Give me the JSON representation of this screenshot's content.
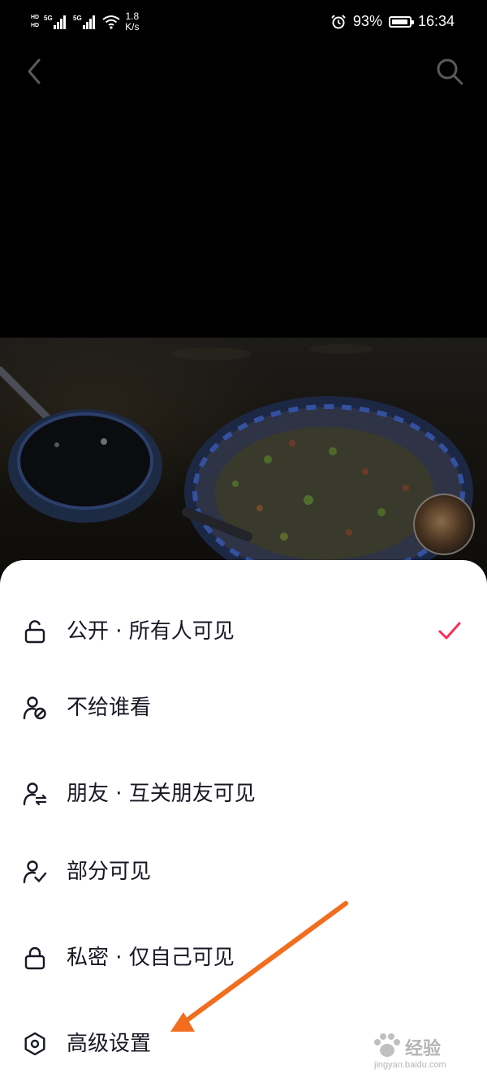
{
  "status_bar": {
    "hd1": "HD",
    "hd2": "HD",
    "net1": "5G",
    "net2": "5G",
    "speed_value": "1.8",
    "speed_unit": "K/s",
    "battery": "93%",
    "battery_level": 0.93,
    "time": "16:34"
  },
  "nav": {
    "back_icon": "chevron-left-icon",
    "search_icon": "search-icon"
  },
  "privacy_options": [
    {
      "label": "公开 · 所有人可见",
      "icon": "unlock-icon",
      "selected": true
    },
    {
      "label": "不给谁看",
      "icon": "user-blocked-icon",
      "selected": false
    },
    {
      "label": "朋友 · 互关朋友可见",
      "icon": "user-mutual-icon",
      "selected": false
    },
    {
      "label": "部分可见",
      "icon": "user-check-icon",
      "selected": false
    },
    {
      "label": "私密 · 仅自己可见",
      "icon": "lock-icon",
      "selected": false
    },
    {
      "label": "高级设置",
      "icon": "settings-hexagon-icon",
      "selected": false
    }
  ],
  "colors": {
    "check": "#fe2c55",
    "annotation_arrow": "#f26d1e",
    "label_text": "#161823"
  },
  "watermark": {
    "title": "经验",
    "url": "jingyan.baidu.com"
  }
}
